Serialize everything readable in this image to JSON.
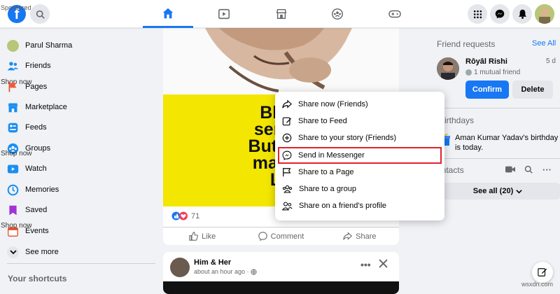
{
  "topbar": {
    "sponsored_label": "Sponsored",
    "logo_letter": "f",
    "nav_tabs": [
      "home",
      "watch",
      "marketplace",
      "groups",
      "gaming"
    ]
  },
  "sidebar": {
    "shop_now": "Shop now",
    "items": [
      {
        "label": "Parul Sharma",
        "icon": "avatar"
      },
      {
        "label": "Friends",
        "icon": "friends-icon"
      },
      {
        "label": "Pages",
        "icon": "pages-flag-icon"
      },
      {
        "label": "Marketplace",
        "icon": "marketplace-icon"
      },
      {
        "label": "Feeds",
        "icon": "feeds-icon"
      },
      {
        "label": "Groups",
        "icon": "groups-icon"
      },
      {
        "label": "Watch",
        "icon": "watch-icon"
      },
      {
        "label": "Memories",
        "icon": "memories-icon"
      },
      {
        "label": "Saved",
        "icon": "saved-icon"
      },
      {
        "label": "Events",
        "icon": "events-icon"
      },
      {
        "label": "See more",
        "icon": "chevron-down-icon"
      }
    ],
    "shortcuts_title": "Your shortcuts"
  },
  "post1": {
    "image_text_lines": [
      "Black c",
      "sentimer",
      "But, every",
      "makes th",
      "Life I"
    ],
    "reaction_count": "71",
    "actions": {
      "like": "Like",
      "comment": "Comment",
      "share": "Share"
    }
  },
  "share_menu": {
    "items": [
      {
        "label": "Share now (Friends)",
        "icon": "share-arrow-icon"
      },
      {
        "label": "Share to Feed",
        "icon": "edit-icon"
      },
      {
        "label": "Share to your story (Friends)",
        "icon": "add-story-icon"
      },
      {
        "label": "Send in Messenger",
        "icon": "messenger-icon"
      },
      {
        "label": "Share to a Page",
        "icon": "flag-icon"
      },
      {
        "label": "Share to a group",
        "icon": "group-icon"
      },
      {
        "label": "Share on a friend's profile",
        "icon": "friend-profile-icon"
      }
    ],
    "highlighted_index": 3
  },
  "post2": {
    "author": "Him & Her",
    "time": "about an hour ago · "
  },
  "right": {
    "friend_requests_title": "Friend requests",
    "see_all": "See All",
    "request": {
      "name": "Rôyâl Rishi",
      "age": "5 d",
      "mutual": "1 mutual friend",
      "confirm": "Confirm",
      "delete": "Delete"
    },
    "birthdays_title": "irthdays",
    "birthday_text_1": "Aman Kumar Yadav's birthday",
    "birthday_text_2": "is today.",
    "contacts_title": "ontacts",
    "see_all_count": "See all (20)"
  },
  "watermark": "wsxdn.com",
  "colors": {
    "accent": "#1877f2",
    "highlight_border": "#e0242a",
    "image_bg": "#f3e600"
  }
}
